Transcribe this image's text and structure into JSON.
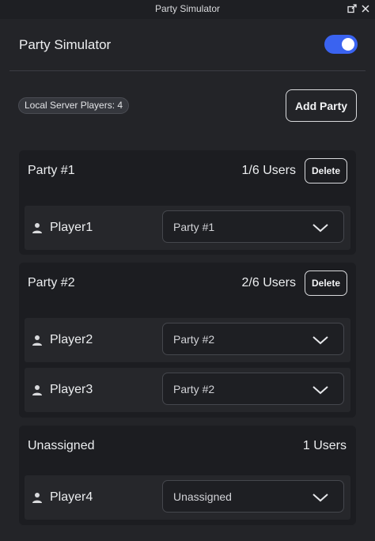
{
  "window": {
    "title": "Party Simulator",
    "controls": [
      "popout-icon",
      "close-icon"
    ]
  },
  "header": {
    "title": "Party Simulator",
    "toggle_on": true,
    "accent_color": "#3a63f0"
  },
  "local_players_label": "Local Server Players: 4",
  "add_party_label": "Add Party",
  "parties": [
    {
      "name": "Party #1",
      "count": "1/6 Users",
      "delete_label": "Delete",
      "players": [
        {
          "name": "Player1",
          "party": "Party #1"
        }
      ]
    },
    {
      "name": "Party #2",
      "count": "2/6 Users",
      "delete_label": "Delete",
      "players": [
        {
          "name": "Player2",
          "party": "Party #2"
        },
        {
          "name": "Player3",
          "party": "Party #2"
        }
      ]
    }
  ],
  "unassigned": {
    "name": "Unassigned",
    "count": "1 Users",
    "players": [
      {
        "name": "Player4",
        "party": "Unassigned"
      }
    ]
  }
}
